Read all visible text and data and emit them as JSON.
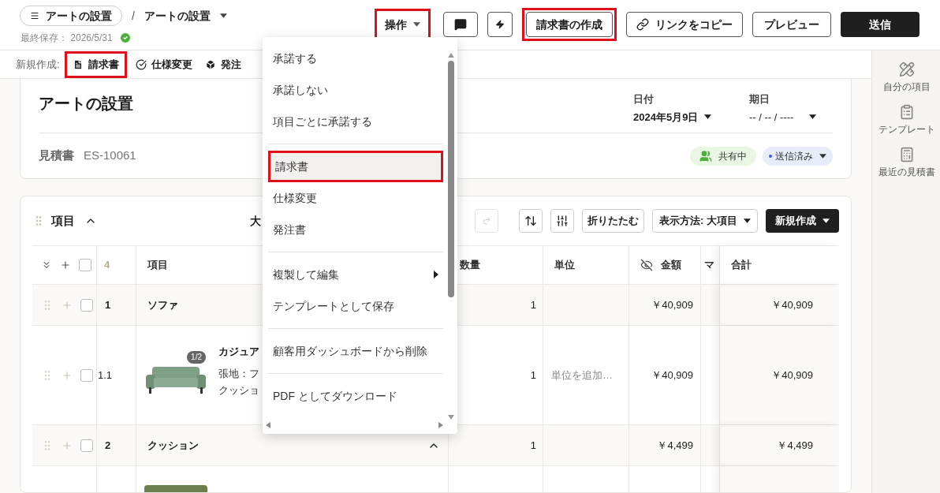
{
  "header": {
    "breadcrumb_parent": "アートの設置",
    "separator": "/",
    "breadcrumb_current": "アートの設置",
    "last_saved": "最終保存： 2026/5/31",
    "saved": true
  },
  "actions": [
    {
      "label": "操作",
      "kind": "menu",
      "highlighted": true
    },
    {
      "label": "請求書の作成",
      "kind": "outline",
      "highlighted": true
    },
    {
      "label": "リンクをコピー",
      "kind": "link",
      "highlighted": false
    },
    {
      "label": "プレビュー",
      "kind": "outline",
      "highlighted": false
    },
    {
      "label": "送信",
      "kind": "primary",
      "highlighted": false
    }
  ],
  "new_bar": {
    "label": "新規作成:",
    "items": [
      {
        "label": "請求書",
        "kind": "invoice",
        "highlighted": true
      },
      {
        "label": "仕様変更",
        "kind": "change",
        "highlighted": false
      },
      {
        "label": "発注",
        "kind": "order",
        "highlighted": false
      }
    ]
  },
  "menu": {
    "groups": [
      [
        {
          "label": "承諾する",
          "selected": false,
          "submenu": false
        },
        {
          "label": "承諾しない",
          "selected": false,
          "submenu": false
        },
        {
          "label": "項目ごとに承諾する",
          "selected": false,
          "submenu": false
        }
      ],
      [
        {
          "label": "請求書",
          "selected": true,
          "submenu": false
        },
        {
          "label": "仕様変更",
          "selected": false,
          "submenu": false
        },
        {
          "label": "発注書",
          "selected": false,
          "submenu": false
        }
      ],
      [
        {
          "label": "複製して編集",
          "selected": false,
          "submenu": true
        },
        {
          "label": "テンプレートとして保存",
          "selected": false,
          "submenu": false
        }
      ],
      [
        {
          "label": "顧客用ダッシュボードから削除",
          "selected": false,
          "submenu": false
        }
      ],
      [
        {
          "label": "PDF としてダウンロード",
          "selected": false,
          "submenu": false
        }
      ]
    ]
  },
  "sidebar": [
    {
      "label": "自分の項目",
      "kind": "tools"
    },
    {
      "label": "テンプレート",
      "kind": "template"
    },
    {
      "label": "最近の見積書",
      "kind": "calculator"
    }
  ],
  "summary": {
    "title": "アートの設置",
    "date_label": "日付",
    "date_value": "2024年5月9日",
    "due_label": "期日",
    "due_value": "-- / -- / ----",
    "doc_label": "見積書",
    "doc_number": "ES-10061",
    "shared": "共有中",
    "status": "送信済み"
  },
  "items": {
    "title": "項目",
    "expanded": true,
    "cut_label": "大",
    "collapse": "折りたたむ",
    "view": "表示方法: 大項目",
    "new": "新規作成",
    "table": {
      "count": "4",
      "all_checked": false,
      "columns": [
        "項目",
        "数量",
        "単位",
        "金額",
        "マ",
        "合計"
      ],
      "rows": [
        {
          "kind": "group",
          "number": "1",
          "name": "ソファ",
          "qty": "1",
          "amount": "￥40,909",
          "total": "￥40,909",
          "checked": false
        },
        {
          "kind": "item",
          "number": "1.1",
          "name": "カジュア",
          "lines": [
            "張地：フ",
            "クッショ"
          ],
          "image_count": "1/2",
          "qty": "1",
          "unit_placeholder": "単位を追加…",
          "amount": "￥40,909",
          "total": "￥40,909",
          "checked": false
        },
        {
          "kind": "group",
          "number": "2",
          "name": "クッション",
          "expanded": true,
          "qty": "1",
          "amount": "￥4,499",
          "total": "￥4,499",
          "checked": false
        },
        {
          "kind": "photo"
        }
      ]
    }
  }
}
